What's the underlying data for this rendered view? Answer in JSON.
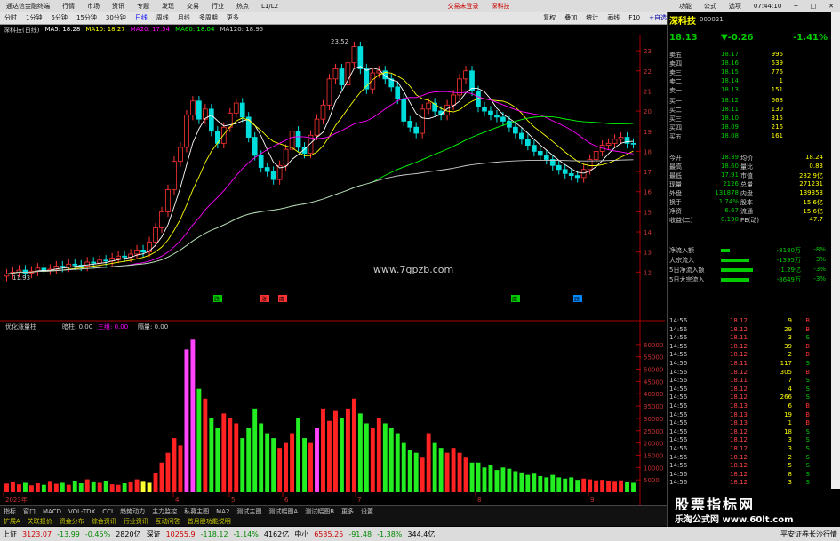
{
  "titlebar": {
    "app": "通达信金融终端",
    "menus": [
      "行情",
      "市场",
      "资讯",
      "专题",
      "发现",
      "交易",
      "行业",
      "热点",
      "L1/L2"
    ],
    "trade_warn": "交易未登录",
    "code_label": "深科技",
    "right": [
      "功能",
      "公式",
      "选项",
      "07:44:10"
    ]
  },
  "toolbar": {
    "periods": [
      "分时",
      "1分钟",
      "5分钟",
      "15分钟",
      "30分钟",
      "日线",
      "周线",
      "月线",
      "多周期",
      "更多"
    ],
    "active": "日线",
    "right_items": [
      "复权",
      "叠加",
      "统计",
      "画线",
      "F10",
      "+自选"
    ],
    "stock_name": "深科技",
    "stock_code": "000021"
  },
  "info": {
    "label": "深科技(日线)",
    "ma5": "MA5: 18.28",
    "ma10": "MA10: 18.27",
    "ma20": "MA20: 17.54",
    "ma60": "MA60: 18.04",
    "ma120": "MA120: 18.95"
  },
  "chart_data": [
    {
      "type": "candlestick",
      "title": "深科技(日线)",
      "ylim": [
        11.0,
        23.8
      ],
      "yticks": [
        12.0,
        13.0,
        14.0,
        15.0,
        16.0,
        17.0,
        18.0,
        19.0,
        20.0,
        21.0,
        22.0,
        23.0
      ],
      "annotations": [
        "23.52",
        "11.93"
      ],
      "closes": [
        11.9,
        12.0,
        12.1,
        11.95,
        12.05,
        12.2,
        12.1,
        12.15,
        12.3,
        12.25,
        12.4,
        12.35,
        12.3,
        12.5,
        12.45,
        12.6,
        12.55,
        12.7,
        12.8,
        12.75,
        12.9,
        13.1,
        13.0,
        13.5,
        14.2,
        15.0,
        16.1,
        17.5,
        18.2,
        19.8,
        20.5,
        19.6,
        20.1,
        19.0,
        18.4,
        19.2,
        19.9,
        20.4,
        19.7,
        18.7,
        17.8,
        17.2,
        17.0,
        16.6,
        17.3,
        18.1,
        19.0,
        18.2,
        17.9,
        18.8,
        19.6,
        20.3,
        21.6,
        22.1,
        21.3,
        22.4,
        23.2,
        22.1,
        21.1,
        21.9,
        22.0,
        21.6,
        21.2,
        20.6,
        19.5,
        19.2,
        18.9,
        20.1,
        20.4,
        20.0,
        19.8,
        20.3,
        20.8,
        21.6,
        22.0,
        21.0,
        20.2,
        20.0,
        19.8,
        19.7,
        19.5,
        19.2,
        18.9,
        18.6,
        18.3,
        18.0,
        17.8,
        17.6,
        17.3,
        17.1,
        16.9,
        16.8,
        16.7,
        17.1,
        17.6,
        18.0,
        18.3,
        18.4,
        18.6,
        18.7,
        18.4,
        18.39
      ]
    },
    {
      "type": "bar",
      "title": "优化涨量柱",
      "labels": [
        "暗柱: 0.00",
        "三维: 0.00",
        "隔量: 0.00"
      ],
      "ylim": [
        0,
        65000
      ],
      "yticks": [
        5000,
        10000,
        15000,
        20000,
        25000,
        30000,
        35000,
        40000,
        45000,
        50000,
        55000,
        60000
      ],
      "x_labels": [
        "2023年",
        "4",
        "5",
        "6",
        "7",
        "8",
        "9"
      ],
      "volumes": [
        3500,
        4000,
        3200,
        3800,
        2800,
        3600,
        3000,
        4200,
        3400,
        3800,
        3000,
        4400,
        3600,
        5200,
        4000,
        3800,
        4600,
        3200,
        3000,
        3600,
        4000,
        5200,
        4200,
        3800,
        7600,
        12000,
        16000,
        22000,
        19000,
        58000,
        62000,
        42000,
        38000,
        30000,
        26000,
        32000,
        30000,
        28000,
        22000,
        26000,
        34000,
        28000,
        24000,
        22000,
        18000,
        20000,
        24000,
        30000,
        22000,
        20000,
        26000,
        34000,
        29000,
        33000,
        30000,
        34000,
        38000,
        32000,
        28000,
        26000,
        30000,
        28000,
        26000,
        24000,
        20000,
        17000,
        16000,
        14000,
        24000,
        20000,
        18000,
        16000,
        18000,
        16000,
        14000,
        12000,
        12000,
        10000,
        11000,
        9000,
        10000,
        9500,
        8500,
        8000,
        7000,
        7500,
        6500,
        6000,
        7000,
        6000,
        5500,
        6000,
        5000,
        5500,
        5200,
        4800,
        5000,
        4500,
        4200,
        4800,
        4000,
        3800
      ]
    }
  ],
  "signals": [
    "跌",
    "涨",
    "鹰",
    "鹰",
    "跃"
  ],
  "right": {
    "price": "18.13",
    "change": "▼-0.26",
    "pct": "-1.41%",
    "asks": [
      {
        "label": "卖五",
        "price": "18.17",
        "vol": "996"
      },
      {
        "label": "卖四",
        "price": "18.16",
        "vol": "539"
      },
      {
        "label": "卖三",
        "price": "18.15",
        "vol": "776"
      },
      {
        "label": "卖二",
        "price": "18.14",
        "vol": "1"
      },
      {
        "label": "卖一",
        "price": "18.13",
        "vol": "151"
      }
    ],
    "bids": [
      {
        "label": "买一",
        "price": "18.12",
        "vol": "668"
      },
      {
        "label": "买二",
        "price": "18.11",
        "vol": "130"
      },
      {
        "label": "买三",
        "price": "18.10",
        "vol": "315"
      },
      {
        "label": "买四",
        "price": "18.09",
        "vol": "216"
      },
      {
        "label": "买五",
        "price": "18.08",
        "vol": "161"
      }
    ],
    "stats": [
      {
        "a": "今开",
        "b": "18.39",
        "c": "均价",
        "d": "18.24"
      },
      {
        "a": "最高",
        "b": "18.60",
        "c": "量比",
        "d": "0.83"
      },
      {
        "a": "最低",
        "b": "17.91",
        "c": "市值",
        "d": "282.9亿"
      },
      {
        "a": "现量",
        "b": "2126",
        "c": "总量",
        "d": "271231"
      },
      {
        "a": "外盘",
        "b": "131878",
        "c": "内盘",
        "d": "139353"
      },
      {
        "a": "换手",
        "b": "1.74%",
        "c": "股本",
        "d": "15.6亿"
      },
      {
        "a": "净资",
        "b": "6.67",
        "c": "流通",
        "d": "15.6亿"
      },
      {
        "a": "收益(二)",
        "b": "0.190",
        "c": "PE(动)",
        "d": "47.7"
      }
    ],
    "flows": [
      {
        "label": "净流入额",
        "val": "-8180万",
        "pct": "-8%"
      },
      {
        "label": "大宗流入",
        "val": "-1395万",
        "pct": "-3%"
      },
      {
        "label": "5日净流入额",
        "val": "-1.29亿",
        "pct": "-3%"
      },
      {
        "label": "5日大宗流入",
        "val": "-8649万",
        "pct": "-3%"
      }
    ],
    "ticks": [
      {
        "t": "14:56",
        "p": "18.12",
        "v": "9",
        "bs": "B"
      },
      {
        "t": "14:56",
        "p": "18.12",
        "v": "29",
        "bs": "B"
      },
      {
        "t": "14:56",
        "p": "18.11",
        "v": "3",
        "bs": "S"
      },
      {
        "t": "14:56",
        "p": "18.12",
        "v": "39",
        "bs": "B"
      },
      {
        "t": "14:56",
        "p": "18.12",
        "v": "2",
        "bs": "B"
      },
      {
        "t": "14:56",
        "p": "18.11",
        "v": "117",
        "bs": "S"
      },
      {
        "t": "14:56",
        "p": "18.12",
        "v": "305",
        "bs": "B"
      },
      {
        "t": "14:56",
        "p": "18.11",
        "v": "7",
        "bs": "S"
      },
      {
        "t": "14:56",
        "p": "18.12",
        "v": "4",
        "bs": "S"
      },
      {
        "t": "14:56",
        "p": "18.12",
        "v": "266",
        "bs": "S"
      },
      {
        "t": "14:56",
        "p": "18.13",
        "v": "6",
        "bs": "B"
      },
      {
        "t": "14:56",
        "p": "18.13",
        "v": "19",
        "bs": "B"
      },
      {
        "t": "14:56",
        "p": "18.13",
        "v": "1",
        "bs": "B"
      },
      {
        "t": "14:56",
        "p": "18.12",
        "v": "18",
        "bs": "S"
      },
      {
        "t": "14:56",
        "p": "18.12",
        "v": "3",
        "bs": "S"
      },
      {
        "t": "14:56",
        "p": "18.12",
        "v": "3",
        "bs": "S"
      },
      {
        "t": "14:56",
        "p": "18.12",
        "v": "2",
        "bs": "S"
      },
      {
        "t": "14:56",
        "p": "18.12",
        "v": "5",
        "bs": "S"
      },
      {
        "t": "14:56",
        "p": "18.12",
        "v": "8",
        "bs": "S"
      },
      {
        "t": "14:56",
        "p": "18.12",
        "v": "3",
        "bs": "S"
      }
    ]
  },
  "bottomtabs": [
    "指标",
    "窗口",
    "MACD",
    "VOL-TDX",
    "CCI",
    "趋势动力",
    "主力监控",
    "私募主图",
    "MA2",
    "测试主图",
    "测试幅图A",
    "测试幅图B",
    "更多",
    "设置"
  ],
  "bottomtabs2": [
    "扩展A",
    "关联报价",
    "资金分布",
    "综合资讯",
    "行业资讯",
    "互动问答",
    "首月股功能说明"
  ],
  "statusbar": [
    {
      "name": "上证",
      "val": "3123.07",
      "chg": "-13.99",
      "pct": "-0.45%",
      "amt": "2820亿"
    },
    {
      "name": "深证",
      "val": "10255.9",
      "chg": "-118.12",
      "pct": "-1.14%",
      "amt": "4162亿"
    },
    {
      "name": "中小",
      "val": "6535.25",
      "chg": "-91.48",
      "pct": "-1.38%",
      "amt": "344.4亿"
    }
  ],
  "broker": "平安证券长沙行情",
  "watermarks": [
    "www.7gpzb.com",
    "股票指标网",
    "乐淘公式网 www.60lt.com"
  ],
  "colors": {
    "up": "#ff3333",
    "down": "#00cc00",
    "bg": "#000000"
  }
}
